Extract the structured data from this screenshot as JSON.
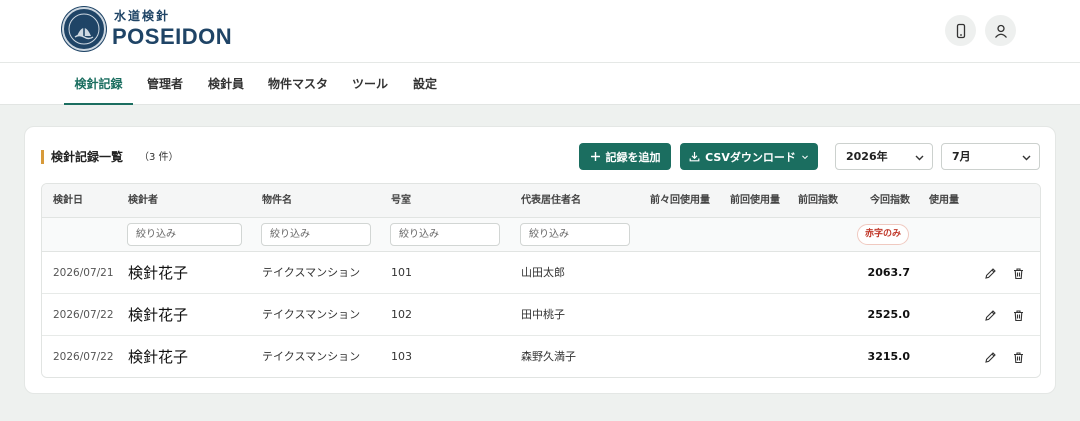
{
  "brand": {
    "sub": "水道検針",
    "name": "POSEIDON"
  },
  "header": {
    "icons": [
      "mobile-icon",
      "user-icon"
    ]
  },
  "nav": [
    {
      "label": "検針記録",
      "active": true
    },
    {
      "label": "管理者",
      "active": false
    },
    {
      "label": "検針員",
      "active": false
    },
    {
      "label": "物件マスタ",
      "active": false
    },
    {
      "label": "ツール",
      "active": false
    },
    {
      "label": "設定",
      "active": false
    }
  ],
  "panel": {
    "title": "検針記録一覧",
    "count": "（3 件）",
    "add_button": "記録を追加",
    "csv_button": "CSVダウンロード",
    "year_select": "2026年",
    "month_select": "7月"
  },
  "table": {
    "headers": [
      "検針日",
      "検針者",
      "物件名",
      "号室",
      "代表居住者名",
      "前々回使用量",
      "前回使用量",
      "前回指数",
      "今回指数",
      "使用量"
    ],
    "filter_placeholder": "絞り込み",
    "negative_filter": "赤字のみ",
    "rows": [
      {
        "date": "2026/07/21",
        "meter_reader": "検針花子",
        "property": "テイクスマンション",
        "room": "101",
        "resident": "山田太郎",
        "current_index": "2063.7"
      },
      {
        "date": "2026/07/22",
        "meter_reader": "検針花子",
        "property": "テイクスマンション",
        "room": "102",
        "resident": "田中桃子",
        "current_index": "2525.0"
      },
      {
        "date": "2026/07/22",
        "meter_reader": "検針花子",
        "property": "テイクスマンション",
        "room": "103",
        "resident": "森野久満子",
        "current_index": "3215.0"
      }
    ]
  },
  "colors": {
    "accent": "#1b6e60",
    "brand": "#1f4466",
    "title_bar": "#d79a3a",
    "negative": "#c0392b"
  }
}
